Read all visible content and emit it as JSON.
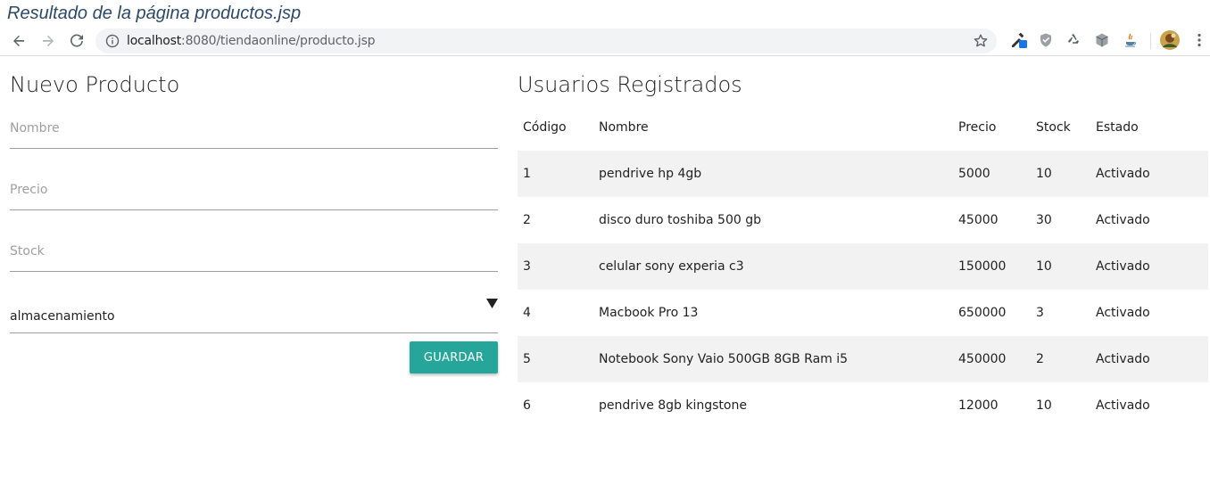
{
  "caption": "Resultado de la página productos.jsp",
  "browser": {
    "url_host": "localhost",
    "url_rest": ":8080/tiendaonline/producto.jsp",
    "icons": [
      "back-icon",
      "forward-icon",
      "reload-icon",
      "info-icon",
      "star-icon",
      "eyedropper-extension-icon",
      "shield-extension-icon",
      "recycle-extension-icon",
      "cube-extension-icon",
      "java-extension-icon",
      "avatar",
      "menu-icon"
    ]
  },
  "form": {
    "title": "Nuevo Producto",
    "nombre_placeholder": "Nombre",
    "precio_placeholder": "Precio",
    "stock_placeholder": "Stock",
    "category_selected": "almacenamiento",
    "save_label": "GUARDAR"
  },
  "users": {
    "title": "Usuarios Registrados",
    "headers": [
      "Código",
      "Nombre",
      "Precio",
      "Stock",
      "Estado"
    ],
    "rows": [
      [
        "1",
        "pendrive hp 4gb",
        "5000",
        "10",
        "Activado"
      ],
      [
        "2",
        "disco duro toshiba 500 gb",
        "45000",
        "30",
        "Activado"
      ],
      [
        "3",
        "celular sony experia c3",
        "150000",
        "10",
        "Activado"
      ],
      [
        "4",
        "Macbook Pro 13",
        "650000",
        "3",
        "Activado"
      ],
      [
        "5",
        "Notebook Sony Vaio 500GB 8GB Ram i5",
        "450000",
        "2",
        "Activado"
      ],
      [
        "6",
        "pendrive 8gb kingstone",
        "12000",
        "10",
        "Activado"
      ]
    ]
  },
  "colors": {
    "accent": "#26a69a",
    "row_stripe": "#f2f2f2",
    "caption": "#2b4a6a"
  }
}
